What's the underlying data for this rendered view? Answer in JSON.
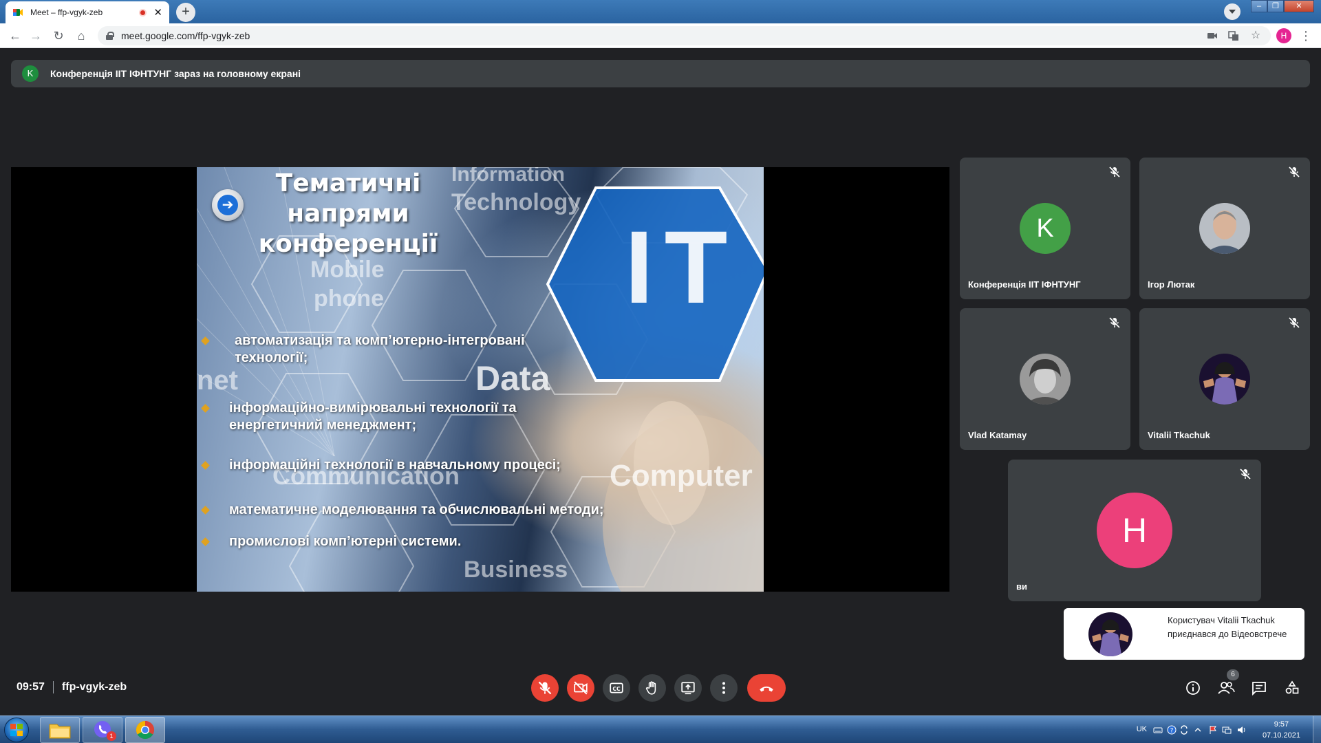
{
  "browser": {
    "tab_title": "Meet – ffp-vgyk-zeb",
    "new_tab_symbol": "+",
    "url": "meet.google.com/ffp-vgyk-zeb",
    "profile_initial": "H"
  },
  "banner": {
    "badge": "K",
    "text": "Конференція ІІТ ІФНТУНГ зараз на головному екрані"
  },
  "slide": {
    "title_lines": [
      "Тематичні",
      "напрями",
      "конференції"
    ],
    "watermarks": {
      "information": "Information",
      "technology": "Technology",
      "mobile": "Mobile",
      "phone": "phone",
      "net": "net",
      "data": "Data",
      "communication": "Communication",
      "computer": "Computer",
      "business": "Business"
    },
    "it_mark": "IT",
    "bullets": [
      "автоматизація та комп’ютерно-інтегровані технології;",
      "інформаційно-вимірювальні технології та енергетичний менеджмент;",
      "інформаційні технології в навчальному процесі;",
      "математичне моделювання та обчислювальні методи;",
      "промислові комп’ютерні системи."
    ]
  },
  "participants": [
    {
      "name": "Конференція ІІТ ІФНТУНГ",
      "initial": "K",
      "color": "#43a047",
      "muted": true
    },
    {
      "name": "Ігор Лютак",
      "muted": true
    },
    {
      "name": "Vlad Katamay",
      "muted": true
    },
    {
      "name": "Vitalii Tkachuk",
      "muted": true
    },
    {
      "name": "ви",
      "initial": "H",
      "color": "#ec407a",
      "muted": true
    }
  ],
  "toast": {
    "text": "Користувач Vitalii Tkachuk приєднався до Відеовстрече"
  },
  "meeting": {
    "time": "09:57",
    "code": "ffp-vgyk-zeb",
    "participant_count": "6"
  },
  "taskbar": {
    "lang": "UK",
    "clock_time": "9:57",
    "clock_date": "07.10.2021",
    "viber_badge": "1"
  },
  "colors": {
    "meet_bg": "#202124",
    "tile_bg": "#3c4043",
    "danger": "#ea4335"
  }
}
